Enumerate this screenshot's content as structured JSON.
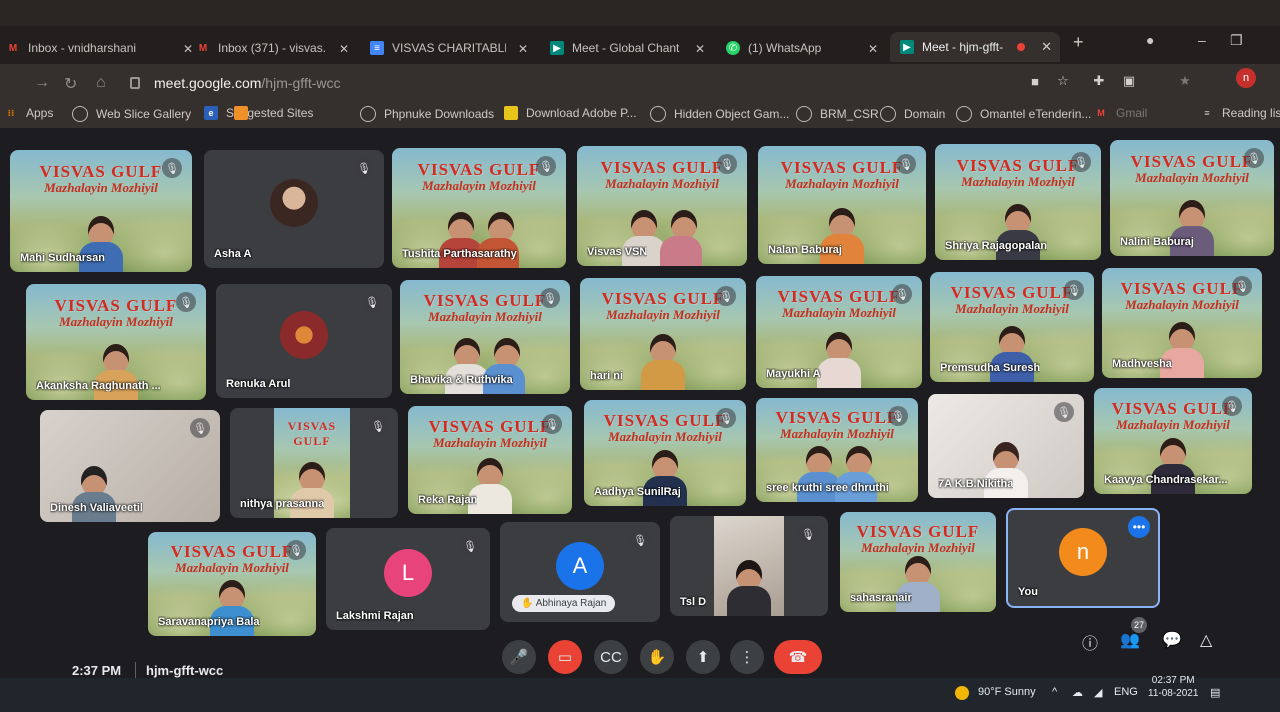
{
  "browser": {
    "tabs": [
      {
        "label": "Inbox - vnidharshani",
        "icon": "gmail-icon",
        "color": "#ea4335"
      },
      {
        "label": "Inbox (371) - visvas.",
        "icon": "gmail-icon",
        "color": "#ea4335"
      },
      {
        "label": "VISVAS CHARITABLE",
        "icon": "docs-icon",
        "color": "#4285f4"
      },
      {
        "label": "Meet - Global Chant",
        "icon": "meet-icon",
        "color": "#00897b"
      },
      {
        "label": "(1) WhatsApp",
        "icon": "whatsapp-icon",
        "color": "#25d366"
      },
      {
        "label": "Meet - hjm-gfft-",
        "icon": "meet-icon",
        "color": "#00897b"
      }
    ],
    "url_host": "meet.google.com",
    "url_path": "/hjm-gfft-wcc",
    "bookmarks": [
      "Apps",
      "Web Slice Gallery",
      "Suggested Sites",
      "Phpnuke Downloads",
      "Download Adobe P...",
      "Hidden Object Gam...",
      "BRM_CSR",
      "Domain",
      "Omantel eTenderin...",
      "Gmail"
    ],
    "reading_list": "Reading list",
    "profile_initial": "n"
  },
  "meet": {
    "banner_line1": "VISVAS GULF",
    "banner_line2": "Mazhalayin Mozhiyil",
    "participants": [
      {
        "name": "Mahi Sudharsan"
      },
      {
        "name": "Asha A"
      },
      {
        "name": "Tushita Parthasarathy"
      },
      {
        "name": "Visvas VSN"
      },
      {
        "name": "Nalan Baburaj"
      },
      {
        "name": "Shriya Rajagopalan"
      },
      {
        "name": "Nalini Baburaj"
      },
      {
        "name": "Akanksha Raghunath ..."
      },
      {
        "name": "Renuka Arul"
      },
      {
        "name": "Bhavika & Ruthvika"
      },
      {
        "name": "hari ni"
      },
      {
        "name": "Mayukhi A"
      },
      {
        "name": "Premsudha Suresh"
      },
      {
        "name": "Madhvesha"
      },
      {
        "name": "Dinesh Valiaveetil"
      },
      {
        "name": "nithya prasanna"
      },
      {
        "name": "Reka Rajan"
      },
      {
        "name": "Aadhya SunilRaj"
      },
      {
        "name": "sree kruthi sree dhruthi"
      },
      {
        "name": "7A K.B.Nikitha"
      },
      {
        "name": "Kaavya Chandrasekar..."
      },
      {
        "name": "Saravanapriya Bala"
      },
      {
        "name": "Lakshmi Rajan",
        "initial": "L",
        "color": "#e8437b"
      },
      {
        "name": "Abhinaya Rajan",
        "initial": "A",
        "color": "#1a73e8"
      },
      {
        "name": "Tsl D"
      },
      {
        "name": "sahasranair"
      },
      {
        "name": "You",
        "initial": "n",
        "color": "#f28b1b"
      }
    ],
    "time": "2:37 PM",
    "meeting_code": "hjm-gfft-wcc",
    "people_count": "27"
  },
  "taskbar": {
    "weather": "90°F  Sunny",
    "lang": "ENG",
    "time": "02:37 PM",
    "date": "11-08-2021"
  }
}
